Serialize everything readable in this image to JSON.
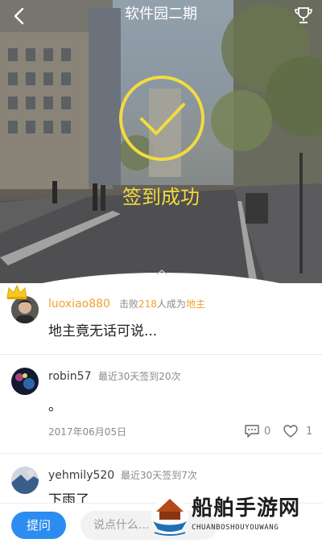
{
  "header": {
    "title": "软件园二期",
    "back_icon": "chevron-left-icon",
    "trophy_icon": "trophy-icon"
  },
  "hero": {
    "check_icon": "checkmark-circle-icon",
    "status_text": "签到成功",
    "accent_color": "#f1db3f"
  },
  "entries": [
    {
      "username": "luoxiao880",
      "meta_prefix": "击败",
      "meta_count": "218",
      "meta_middle": "人成为",
      "meta_title": "地主",
      "message": "地主竟无话可说...",
      "crown_icon": "crown-icon"
    },
    {
      "username": "robin57",
      "meta": "最近30天签到20次",
      "message": "。",
      "date": "2017年06月05日",
      "comment_count": "0",
      "like_count": "1"
    },
    {
      "username": "yehmily520",
      "meta": "最近30天签到7次",
      "message": "下雨了"
    }
  ],
  "bottom_bar": {
    "ask_label": "提问",
    "input_placeholder": "说点什么..."
  },
  "watermark": {
    "name": "船舶手游网",
    "sub": "CHUANBOSHOUYOUWANG"
  },
  "colors": {
    "highlight": "#f0a12a",
    "primary_button": "#2d8cf0"
  }
}
